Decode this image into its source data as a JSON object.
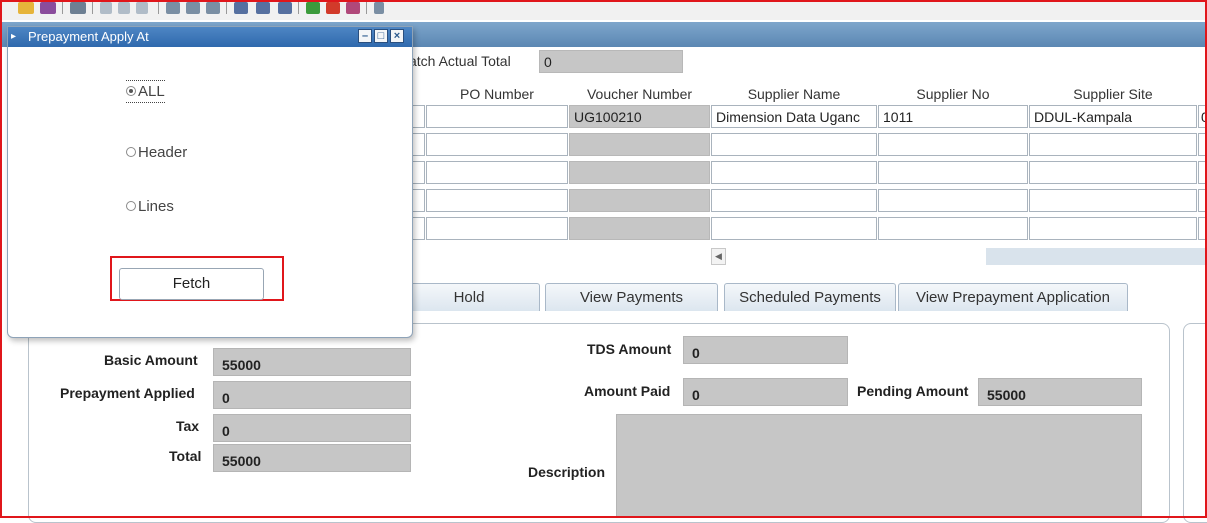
{
  "dialog": {
    "title": "Prepayment Apply At",
    "options": [
      {
        "label": "ALL",
        "selected": true
      },
      {
        "label": "Header",
        "selected": false
      },
      {
        "label": "Lines",
        "selected": false
      }
    ],
    "fetch_label": "Fetch"
  },
  "batch": {
    "actual_total_label": "atch Actual Total",
    "actual_total_value": "0"
  },
  "grid": {
    "headers": [
      "PO Number",
      "Voucher Number",
      "Supplier Name",
      "Supplier No",
      "Supplier Site"
    ],
    "rows": [
      {
        "po": "",
        "voucher": "UG100210",
        "supplier_name": "Dimension Data Uganc",
        "supplier_no": "1011",
        "site": "DDUL-Kampala",
        "extra": "0"
      },
      {
        "po": "",
        "voucher": "",
        "supplier_name": "",
        "supplier_no": "",
        "site": "",
        "extra": ""
      },
      {
        "po": "",
        "voucher": "",
        "supplier_name": "",
        "supplier_no": "",
        "site": "",
        "extra": ""
      },
      {
        "po": "",
        "voucher": "",
        "supplier_name": "",
        "supplier_no": "",
        "site": "",
        "extra": ""
      },
      {
        "po": "",
        "voucher": "",
        "supplier_name": "",
        "supplier_no": "",
        "site": "",
        "extra": ""
      }
    ]
  },
  "tabs": [
    "Hold",
    "View Payments",
    "Scheduled Payments",
    "View Prepayment Application"
  ],
  "amounts": {
    "basic_amount_label": "Basic Amount",
    "basic_amount": "55000",
    "prepayment_applied_label": "Prepayment Applied",
    "prepayment_applied": "0",
    "tax_label": "Tax",
    "tax": "0",
    "total_label": "Total",
    "total": "55000",
    "tds_amount_label": "TDS Amount",
    "tds_amount": "0",
    "amount_paid_label": "Amount Paid",
    "amount_paid": "0",
    "pending_amount_label": "Pending Amount",
    "pending_amount": "55000",
    "description_label": "Description",
    "description": ""
  },
  "colors": {
    "highlight": "#e0161b",
    "titlebar": "#2f69ad",
    "readonly_field": "#c6c6c6"
  }
}
